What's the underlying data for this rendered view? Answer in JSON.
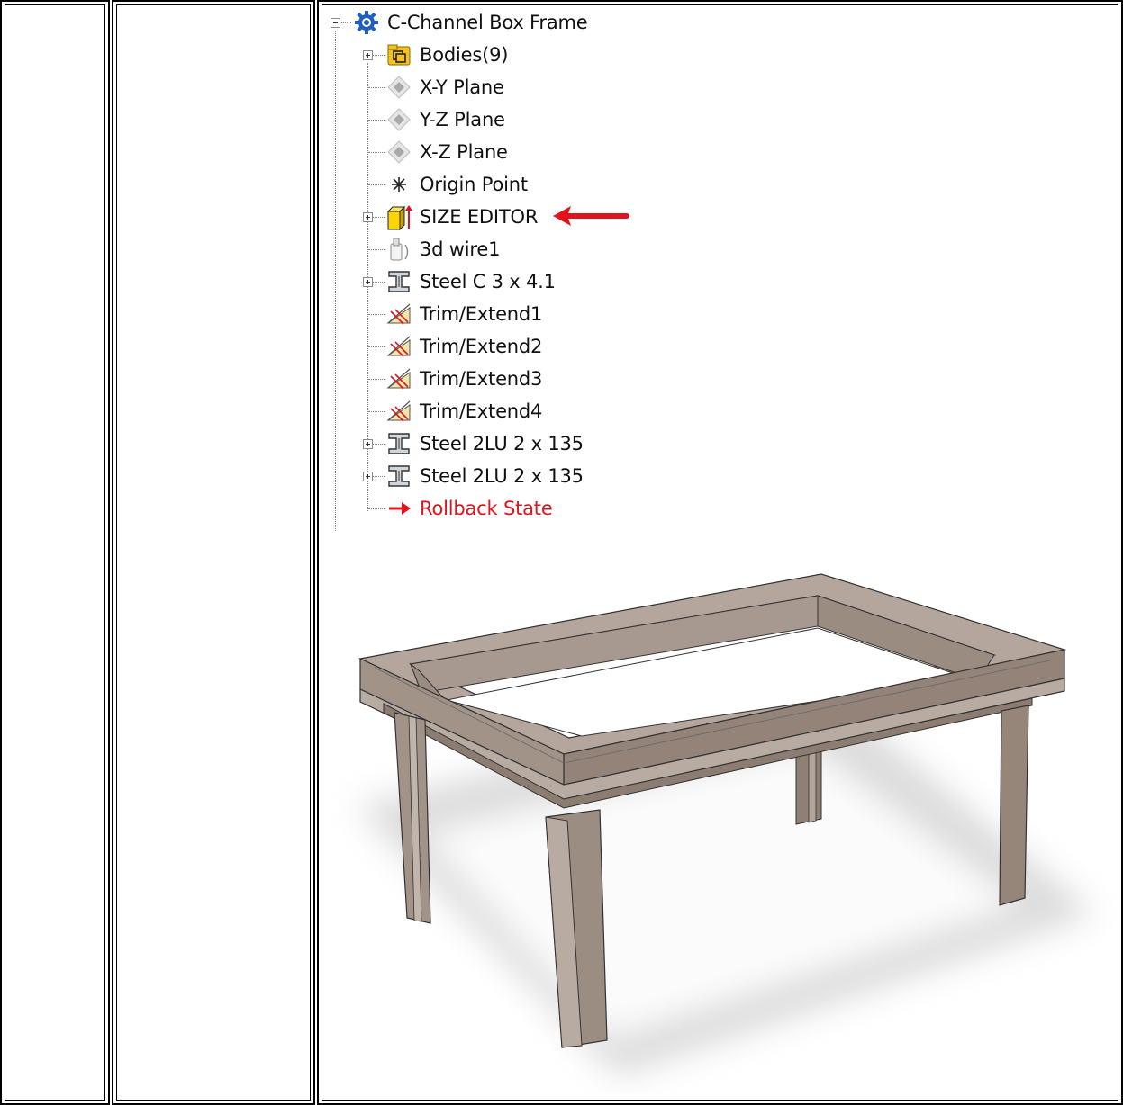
{
  "tree": {
    "root": {
      "label": "C-Channel Box Frame",
      "icon": "gear-part-icon",
      "expanded": true
    },
    "items": [
      {
        "label": "Bodies(9)",
        "icon": "bodies-folder-icon",
        "expandable": true,
        "color": "#111"
      },
      {
        "label": "X-Y Plane",
        "icon": "plane-icon",
        "expandable": false,
        "color": "#111"
      },
      {
        "label": "Y-Z Plane",
        "icon": "plane-icon",
        "expandable": false,
        "color": "#111"
      },
      {
        "label": "X-Z Plane",
        "icon": "plane-icon",
        "expandable": false,
        "color": "#111"
      },
      {
        "label": "Origin Point",
        "icon": "origin-point-icon",
        "expandable": false,
        "color": "#111"
      },
      {
        "label": "SIZE EDITOR",
        "icon": "size-editor-icon",
        "expandable": true,
        "color": "#111"
      },
      {
        "label": "3d wire1",
        "icon": "wire-icon",
        "expandable": false,
        "color": "#111"
      },
      {
        "label": "Steel C  3 x 4.1",
        "icon": "steel-profile-icon",
        "expandable": true,
        "color": "#111"
      },
      {
        "label": "Trim/Extend1",
        "icon": "trim-extend-icon",
        "expandable": false,
        "color": "#111"
      },
      {
        "label": "Trim/Extend2",
        "icon": "trim-extend-icon",
        "expandable": false,
        "color": "#111"
      },
      {
        "label": "Trim/Extend3",
        "icon": "trim-extend-icon",
        "expandable": false,
        "color": "#111"
      },
      {
        "label": "Trim/Extend4",
        "icon": "trim-extend-icon",
        "expandable": false,
        "color": "#111"
      },
      {
        "label": "Steel 2LU  2 x 135",
        "icon": "steel-profile-icon",
        "expandable": true,
        "color": "#111"
      },
      {
        "label": "Steel 2LU  2 x 135",
        "icon": "steel-profile-icon",
        "expandable": true,
        "color": "#111"
      },
      {
        "label": "Rollback State",
        "icon": "rollback-arrow-icon",
        "expandable": false,
        "color": "#e0141e"
      }
    ],
    "annotation": {
      "icon": "red-arrow-icon",
      "target": "SIZE EDITOR",
      "color": "#e0141e"
    }
  },
  "model_view": {
    "description_icon": "c-channel-box-frame-3d-model",
    "frame_color": "#9a8a80"
  }
}
